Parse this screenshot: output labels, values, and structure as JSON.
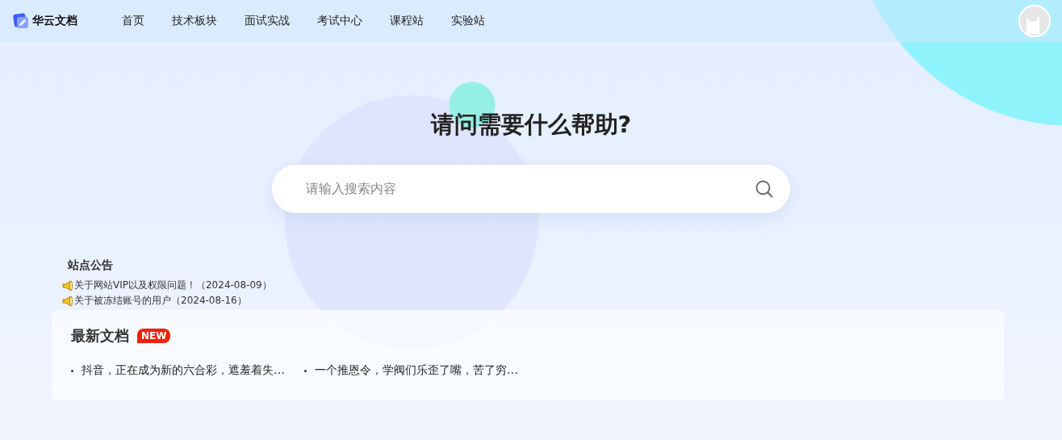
{
  "header": {
    "logo": "华云文档",
    "nav": [
      {
        "label": "首页"
      },
      {
        "label": "技术板块"
      },
      {
        "label": "面试实战"
      },
      {
        "label": "考试中心"
      },
      {
        "label": "课程站"
      },
      {
        "label": "实验站"
      }
    ]
  },
  "hero": {
    "title": "请问需要什么帮助?",
    "search": {
      "placeholder": "请输入搜索内容"
    }
  },
  "notices": {
    "title": "站点公告",
    "items": [
      {
        "text": "关于网站VIP以及权限问题！（2024-08-09）"
      },
      {
        "text": "关于被冻结账号的用户（2024-08-16）"
      }
    ]
  },
  "latest": {
    "title": "最新文档",
    "badge": "NEW",
    "items": [
      {
        "text": "抖音，正在成为新的六合彩，遮羞着失…"
      },
      {
        "text": "一个推恩令，学阀们乐歪了嘴，苦了穷…"
      }
    ]
  }
}
